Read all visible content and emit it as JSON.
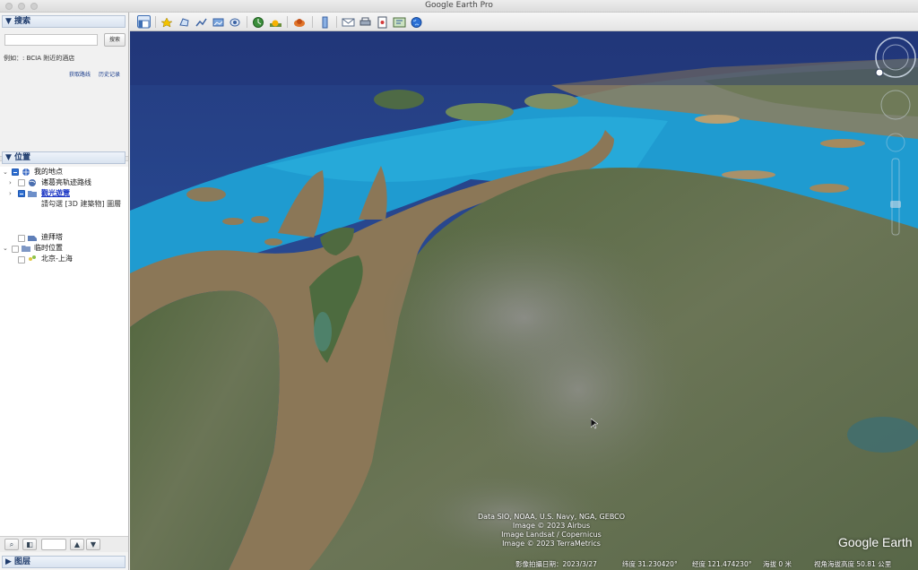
{
  "window": {
    "title": "Google Earth Pro"
  },
  "sidebar": {
    "search": {
      "header": "▼ 搜索",
      "placeholder": "",
      "button": "搜索",
      "example": "例如：: BCIA 附近的酒店",
      "get_directions": "获取路线",
      "history": "历史记录"
    },
    "places": {
      "header": "▼ 位置",
      "items": [
        {
          "label": "我的地点",
          "checked": true,
          "expanded": true
        },
        {
          "label": "诸葛亮轨迹路线",
          "checked": false,
          "expanded": false
        },
        {
          "label": "觀光遊覽",
          "checked": true,
          "expanded": false,
          "link": true
        },
        {
          "label": "請勾選 [3D 建築物] 圖層",
          "sub": true
        },
        {
          "label": "迪拜塔",
          "checked": false
        },
        {
          "label": "临时位置",
          "checked": false,
          "expanded": true
        },
        {
          "label": "北京-上海",
          "checked": false
        }
      ]
    },
    "layers": {
      "header": "▶ 图层"
    }
  },
  "toolbar": {
    "icons": [
      "sidebar-toggle-icon",
      "add-placemark-icon",
      "add-polygon-icon",
      "add-path-icon",
      "add-image-overlay-icon",
      "record-tour-icon",
      "historical-imagery-icon",
      "sunlight-icon",
      "switch-planet-icon",
      "ruler-icon",
      "email-icon",
      "print-icon",
      "save-image-icon",
      "view-in-maps-icon",
      "earth-icon"
    ]
  },
  "map": {
    "attribution": [
      "Data SIO, NOAA, U.S. Navy, NGA, GEBCO",
      "Image © 2023 Airbus",
      "Image Landsat / Copernicus",
      "Image © 2023 TerraMetrics"
    ],
    "logo": "Google Earth",
    "status": {
      "imagery_date": "影像拍攝日期：2023/3/27",
      "lat": "纬度   31.230420°",
      "lon": "经度  121.474230°",
      "elev": "海拔     0 米",
      "eye_alt": "视角海拔高度  50.81 公里"
    }
  },
  "colors": {
    "accent": "#2f6fd1",
    "sea_deep": "#27437f",
    "sea_shallow": "#1f9bd0",
    "river": "#8b7757",
    "land": "#5c6a48"
  }
}
